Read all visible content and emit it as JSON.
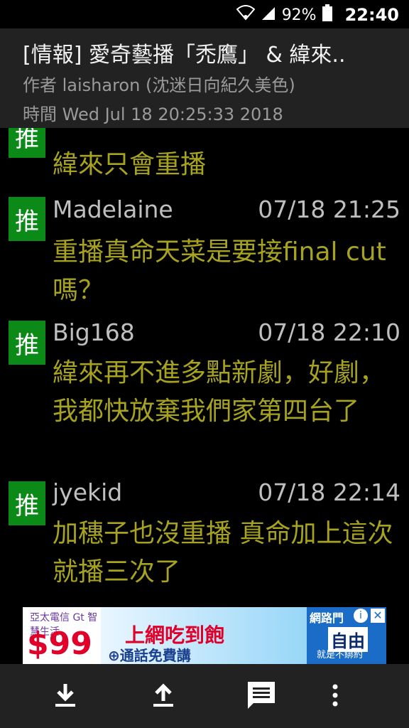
{
  "status_bar": {
    "battery": "92%",
    "time": "22:40"
  },
  "article": {
    "title": "[情報] 愛奇藝播「禿鷹」 & 緯來..",
    "author": "作者 laisharon (沈迷日向紀久美色)",
    "time": "時間 Wed Jul 18 20:25:33 2018"
  },
  "comments": [
    {
      "tag": "推",
      "user": "",
      "time": "",
      "text": "緯來只會重播"
    },
    {
      "tag": "推",
      "user": "Madelaine",
      "time": "07/18 21:25",
      "text": "重播真命天菜是要接final cut嗎？"
    },
    {
      "tag": "推",
      "user": "Big168",
      "time": "07/18 22:10",
      "text": "緯來再不進多點新劇，好劇，我都快放棄我們家第四台了"
    },
    {
      "tag": "推",
      "user": "jyekid",
      "time": "07/18 22:14",
      "text": "加穗子也沒重播 真命加上這次 就播三次了"
    }
  ],
  "ad": {
    "brand": "亞太電信 Gt 智慧生活",
    "price": "$99",
    "headline": "上網吃到飽",
    "sub": "⊕通話免費講",
    "network": "網路門",
    "free": "自由",
    "tagline": "就是不綁約",
    "info": "i",
    "close": "✕"
  }
}
